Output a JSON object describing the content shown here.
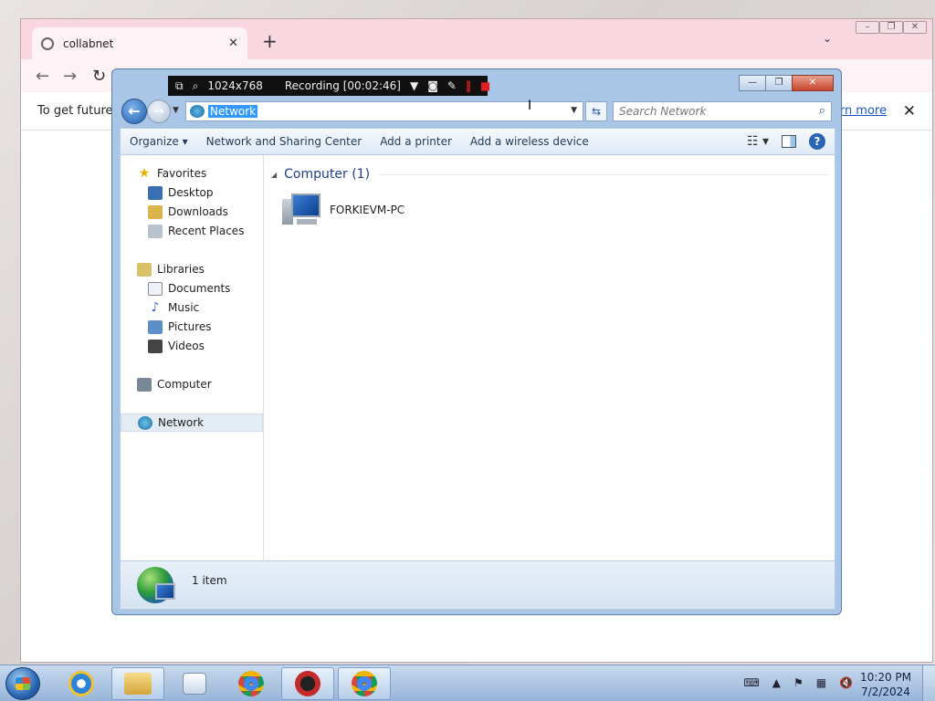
{
  "chrome": {
    "tab_title": "collabnet",
    "tab_close": "✕",
    "new_tab": "+",
    "infobar_text": "To get future G",
    "learn_more": "earn more",
    "infobar_close": "✕"
  },
  "recorder": {
    "resolution": "1024x768",
    "status": "Recording [00:02:46]"
  },
  "explorer": {
    "address": "Network",
    "search_placeholder": "Search Network",
    "commands": [
      "Organize",
      "Network and Sharing Center",
      "Add a printer",
      "Add a wireless device"
    ],
    "nav": {
      "favorites": "Favorites",
      "desktop": "Desktop",
      "downloads": "Downloads",
      "recent": "Recent Places",
      "libraries": "Libraries",
      "documents": "Documents",
      "music": "Music",
      "pictures": "Pictures",
      "videos": "Videos",
      "computer": "Computer",
      "network": "Network"
    },
    "group_label": "Computer (1)",
    "items": [
      {
        "name": "FORKIEVM-PC"
      }
    ],
    "item_count": "1 item"
  },
  "taskbar": {
    "time": "10:20 PM",
    "date": "7/2/2024"
  },
  "colors": {
    "selection": "#3399ff",
    "chrome_tabbar": "#f8d7e1",
    "group_header": "#1e3d8a"
  }
}
